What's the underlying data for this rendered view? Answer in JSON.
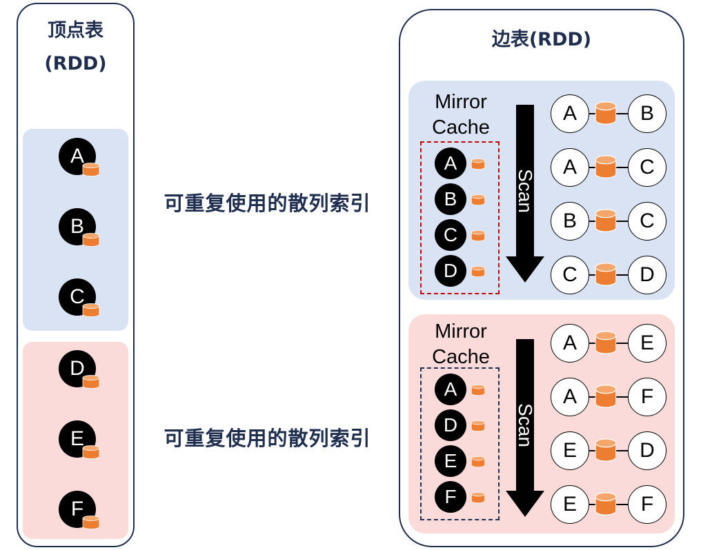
{
  "vertex_table": {
    "title_line1": "顶点表",
    "title_line2": "(RDD)",
    "partitions": [
      {
        "color": "#dae3f3",
        "vertices": [
          "A",
          "B",
          "C"
        ]
      },
      {
        "color": "#fbdada",
        "vertices": [
          "D",
          "E",
          "F"
        ]
      }
    ]
  },
  "middle_labels": [
    "可重复使用的散列索引",
    "可重复使用的散列索引"
  ],
  "edge_table": {
    "title": "边表(RDD)",
    "partitions": [
      {
        "color": "#dae3f3",
        "cache_title_line1": "Mirror",
        "cache_title_line2": "Cache",
        "cache_border_color": "#c00000",
        "cache_vertices": [
          "A",
          "B",
          "C",
          "D"
        ],
        "scan_label": "Scan",
        "edges": [
          [
            "A",
            "B"
          ],
          [
            "A",
            "C"
          ],
          [
            "B",
            "C"
          ],
          [
            "C",
            "D"
          ]
        ]
      },
      {
        "color": "#fbdada",
        "cache_title_line1": "Mirror",
        "cache_title_line2": "Cache",
        "cache_border_color": "#1f2d4f",
        "cache_vertices": [
          "A",
          "D",
          "E",
          "F"
        ],
        "scan_label": "Scan",
        "edges": [
          [
            "A",
            "E"
          ],
          [
            "A",
            "F"
          ],
          [
            "E",
            "D"
          ],
          [
            "E",
            "F"
          ]
        ]
      }
    ]
  },
  "colors": {
    "navy": "#1f2d4f",
    "cylinder": "#ed7d31",
    "blue_partition": "#dae3f3",
    "pink_partition": "#fbdada"
  }
}
